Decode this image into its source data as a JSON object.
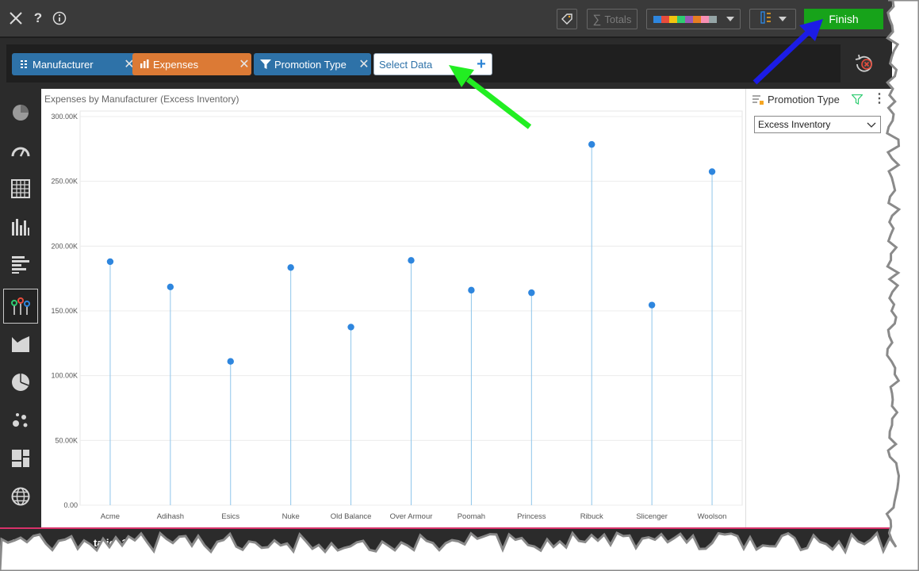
{
  "toolbar": {
    "totals_label": "Totals",
    "finish_label": "Finish",
    "palette_colors": [
      "#2e86de",
      "#e74c3c",
      "#f1c40f",
      "#2ecc71",
      "#9b59b6",
      "#e67e22",
      "#f78fb3",
      "#95a5a6"
    ],
    "icons": [
      "close-icon",
      "help-icon",
      "info-icon",
      "tag-icon",
      "sigma-icon",
      "layout-icon"
    ]
  },
  "datastrip": {
    "chips": [
      {
        "label": "Manufacturer",
        "icon": "grid-icon",
        "color": "#2e72a8"
      },
      {
        "label": "Expenses",
        "icon": "bar-chart-icon",
        "color": "#dc7a35"
      },
      {
        "label": "Promotion Type",
        "icon": "funnel-icon",
        "color": "#2e72a8"
      }
    ],
    "select_label": "Select Data"
  },
  "sidebar": {
    "items": [
      "chart-wizard-icon",
      "gauge-icon",
      "pivot-grid-icon",
      "column-chart-icon",
      "bar-chart-icon",
      "lollipop-chart-icon",
      "area-chart-icon",
      "pie-chart-icon",
      "scatter-chart-icon",
      "treemap-icon",
      "map-icon"
    ],
    "active_index": 5
  },
  "chart_data": {
    "type": "lollipop",
    "title": "Expenses by Manufacturer (Excess Inventory)",
    "categories": [
      "Acme",
      "Adihash",
      "Esics",
      "Nuke",
      "Old Balance",
      "Over Armour",
      "Poomah",
      "Princess",
      "Ribuck",
      "Slicenger",
      "Woolson"
    ],
    "values": [
      188000,
      168500,
      111000,
      183500,
      137500,
      189000,
      166000,
      164000,
      278500,
      154500,
      257500
    ],
    "yticks": [
      "0.00",
      "50.00K",
      "100.00K",
      "150.00K",
      "200.00K",
      "250.00K",
      "300.00K"
    ],
    "ylim": [
      0,
      300000
    ],
    "grid": true,
    "color": "#2e86de"
  },
  "rightpanel": {
    "title": "Promotion Type",
    "selected": "Excess Inventory"
  },
  "bottombar": {
    "tab_label": "tation1"
  }
}
